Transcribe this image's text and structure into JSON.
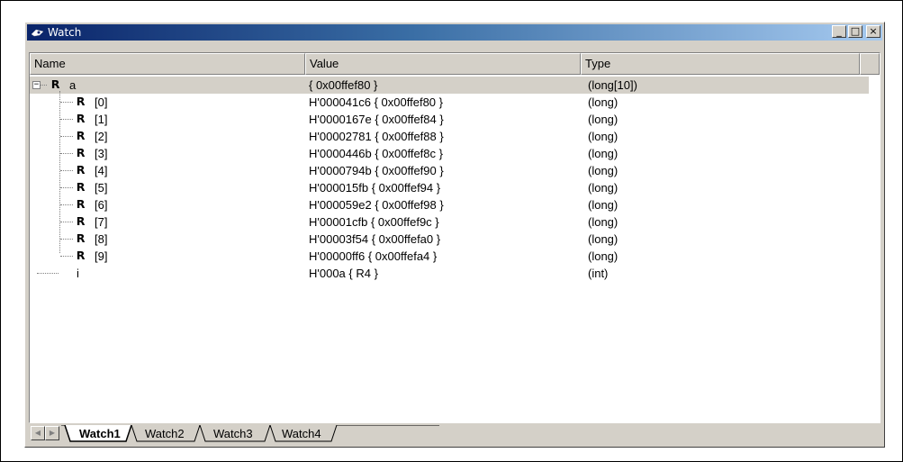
{
  "window": {
    "title": "Watch",
    "minimize_label": "_",
    "maximize_label": "□",
    "close_label": "×"
  },
  "columns": {
    "name": "Name",
    "value": "Value",
    "type": "Type"
  },
  "rows": [
    {
      "name": "a",
      "value": "{ 0x00ffef80 }",
      "type": "(long[10])"
    },
    {
      "name": "[0]",
      "value": "H'000041c6 { 0x00ffef80 }",
      "type": "(long)"
    },
    {
      "name": "[1]",
      "value": "H'0000167e { 0x00ffef84 }",
      "type": "(long)"
    },
    {
      "name": "[2]",
      "value": "H'00002781 { 0x00ffef88 }",
      "type": "(long)"
    },
    {
      "name": "[3]",
      "value": "H'0000446b { 0x00ffef8c }",
      "type": "(long)"
    },
    {
      "name": "[4]",
      "value": "H'0000794b { 0x00ffef90 }",
      "type": "(long)"
    },
    {
      "name": "[5]",
      "value": "H'000015fb { 0x00ffef94 }",
      "type": "(long)"
    },
    {
      "name": "[6]",
      "value": "H'000059e2 { 0x00ffef98 }",
      "type": "(long)"
    },
    {
      "name": "[7]",
      "value": "H'00001cfb { 0x00ffef9c }",
      "type": "(long)"
    },
    {
      "name": "[8]",
      "value": "H'00003f54 { 0x00ffefa0 }",
      "type": "(long)"
    },
    {
      "name": "[9]",
      "value": "H'00000ff6 { 0x00ffefa4 }",
      "type": "(long)"
    },
    {
      "name": "i",
      "value": "H'000a { R4 }",
      "type": "(int)"
    }
  ],
  "tabs": [
    {
      "label": "Watch1",
      "active": true
    },
    {
      "label": "Watch2",
      "active": false
    },
    {
      "label": "Watch3",
      "active": false
    },
    {
      "label": "Watch4",
      "active": false
    }
  ],
  "icons": {
    "register": "R",
    "expander": "−"
  }
}
